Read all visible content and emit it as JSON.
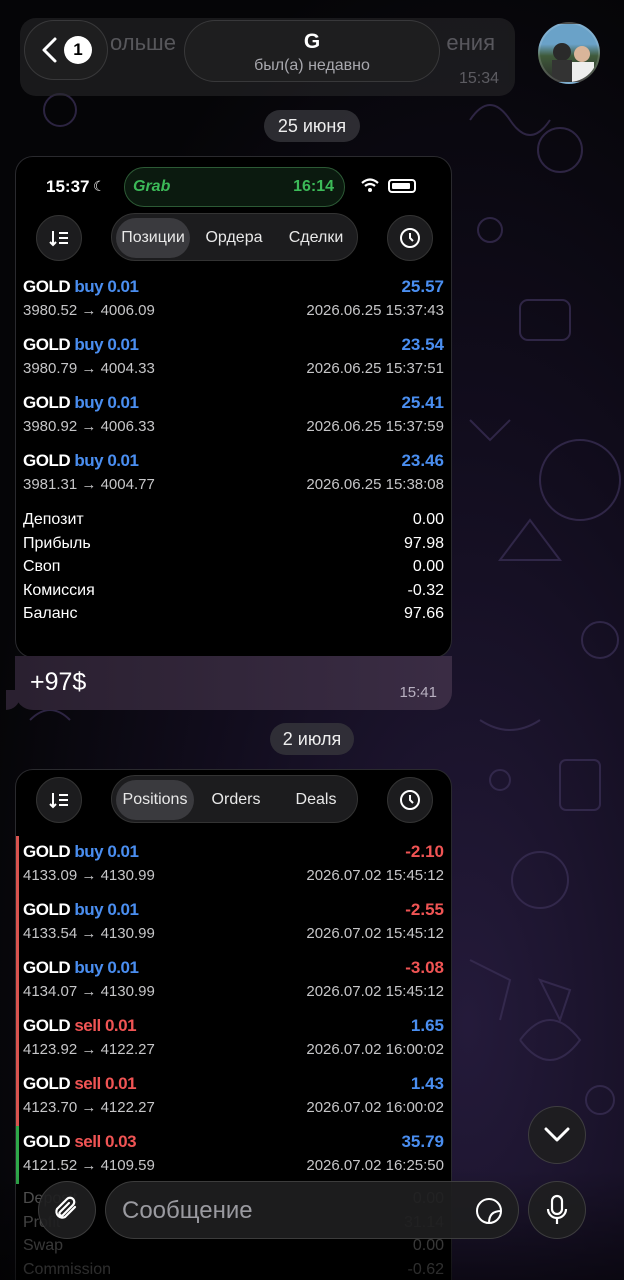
{
  "header": {
    "back_badge": "1",
    "contact_name": "G",
    "contact_status": "был(а) недавно",
    "prev_message_time": "15:34",
    "prev_message_fragment_left": "ольше",
    "prev_message_fragment_right": "ения"
  },
  "date_separators": [
    "25 июня",
    "2 июля"
  ],
  "msg1": {
    "status_time": "15:37",
    "grab_label": "Grab",
    "grab_time": "16:14",
    "tabs": [
      "Позиции",
      "Ордера",
      "Сделки"
    ],
    "active_tab": 0,
    "trades": [
      {
        "symbol": "GOLD",
        "side": "buy",
        "lot": "0.01",
        "profit": "25.57",
        "open": "3980.52",
        "close": "4006.09",
        "datetime": "2026.06.25 15:37:43"
      },
      {
        "symbol": "GOLD",
        "side": "buy",
        "lot": "0.01",
        "profit": "23.54",
        "open": "3980.79",
        "close": "4004.33",
        "datetime": "2026.06.25 15:37:51"
      },
      {
        "symbol": "GOLD",
        "side": "buy",
        "lot": "0.01",
        "profit": "25.41",
        "open": "3980.92",
        "close": "4006.33",
        "datetime": "2026.06.25 15:37:59"
      },
      {
        "symbol": "GOLD",
        "side": "buy",
        "lot": "0.01",
        "profit": "23.46",
        "open": "3981.31",
        "close": "4004.77",
        "datetime": "2026.06.25 15:38:08"
      }
    ],
    "summary": [
      {
        "label": "Депозит",
        "value": "0.00"
      },
      {
        "label": "Прибыль",
        "value": "97.98"
      },
      {
        "label": "Своп",
        "value": "0.00"
      },
      {
        "label": "Комиссия",
        "value": "-0.32"
      },
      {
        "label": "Баланс",
        "value": "97.66"
      }
    ],
    "caption": "+97$",
    "time": "15:41"
  },
  "msg2": {
    "tabs": [
      "Positions",
      "Orders",
      "Deals"
    ],
    "active_tab": 0,
    "trades": [
      {
        "symbol": "GOLD",
        "side": "buy",
        "lot": "0.01",
        "profit": "-2.10",
        "open": "4133.09",
        "close": "4130.99",
        "datetime": "2026.07.02 15:45:12"
      },
      {
        "symbol": "GOLD",
        "side": "buy",
        "lot": "0.01",
        "profit": "-2.55",
        "open": "4133.54",
        "close": "4130.99",
        "datetime": "2026.07.02 15:45:12"
      },
      {
        "symbol": "GOLD",
        "side": "buy",
        "lot": "0.01",
        "profit": "-3.08",
        "open": "4134.07",
        "close": "4130.99",
        "datetime": "2026.07.02 15:45:12"
      },
      {
        "symbol": "GOLD",
        "side": "sell",
        "lot": "0.01",
        "profit": "1.65",
        "open": "4123.92",
        "close": "4122.27",
        "datetime": "2026.07.02 16:00:02"
      },
      {
        "symbol": "GOLD",
        "side": "sell",
        "lot": "0.01",
        "profit": "1.43",
        "open": "4123.70",
        "close": "4122.27",
        "datetime": "2026.07.02 16:00:02"
      },
      {
        "symbol": "GOLD",
        "side": "sell",
        "lot": "0.03",
        "profit": "35.79",
        "open": "4121.52",
        "close": "4109.59",
        "datetime": "2026.07.02 16:25:50"
      }
    ],
    "summary": [
      {
        "label": "Deposit",
        "value": "0.00"
      },
      {
        "label": "Profit",
        "value": "31.14"
      },
      {
        "label": "Swap",
        "value": "0.00"
      },
      {
        "label": "Commission",
        "value": "-0.62"
      }
    ]
  },
  "composer": {
    "placeholder": "Сообщение"
  },
  "colors": {
    "buy": "#4a8ef0",
    "sell": "#f05454",
    "grab_green": "#3cba58",
    "bar_loss": "#d9534f",
    "bar_win": "#2ea84a"
  },
  "icons": [
    "chevron-left-icon",
    "sort-icon",
    "history-clock-icon",
    "wifi-icon",
    "battery-icon",
    "moon-icon",
    "paperclip-icon",
    "sticker-icon",
    "microphone-icon",
    "chevron-down-icon"
  ]
}
